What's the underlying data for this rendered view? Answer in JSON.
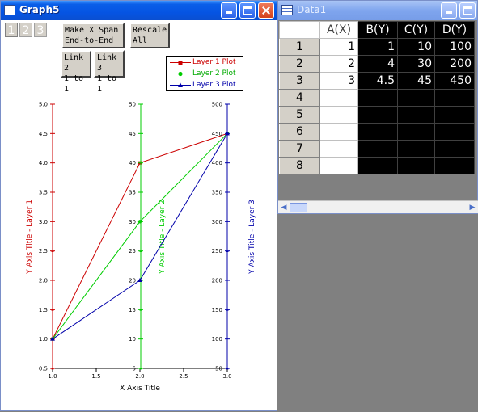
{
  "graph_window": {
    "title": "Graph5",
    "layer_tabs": [
      "1",
      "2",
      "3"
    ],
    "buttons": {
      "make_span_line1": "Make X Span",
      "make_span_line2": "End-to-End",
      "rescale_line1": "Rescale",
      "rescale_line2": "All",
      "link2_line1": "Link 2",
      "link2_line2": "1 to 1",
      "link3_line1": "Link 3",
      "link3_line2": "1 to 1"
    },
    "legend": [
      {
        "label": "Layer 1 Plot",
        "color": "#cc0000",
        "marker": "square"
      },
      {
        "label": "Layer 2 Plot",
        "color": "#00cc00",
        "marker": "circle"
      },
      {
        "label": "Layer 3 Plot",
        "color": "#0000aa",
        "marker": "triangle"
      }
    ]
  },
  "chart_data": {
    "type": "line",
    "xlabel": "X Axis Title",
    "xlim": [
      1.0,
      3.0
    ],
    "xticks": [
      "1.0",
      "1.5",
      "2.0",
      "2.5",
      "3.0"
    ],
    "x": [
      1,
      2,
      3
    ],
    "series": [
      {
        "name": "Layer 1 Plot",
        "axis_title": "Y Axis Title - Layer 1",
        "color": "#cc0000",
        "values": [
          1,
          4,
          4.5
        ],
        "ylim": [
          0.5,
          5.0
        ],
        "yticks": [
          "0.5",
          "1.0",
          "1.5",
          "2.0",
          "2.5",
          "3.0",
          "3.5",
          "4.0",
          "4.5",
          "5.0"
        ]
      },
      {
        "name": "Layer 2 Plot",
        "axis_title": "Y Axis Title - Layer 2",
        "color": "#00cc00",
        "values": [
          10,
          30,
          45
        ],
        "ylim": [
          5,
          50
        ],
        "yticks": [
          "5",
          "10",
          "15",
          "20",
          "25",
          "30",
          "35",
          "40",
          "45",
          "50"
        ]
      },
      {
        "name": "Layer 3 Plot",
        "axis_title": "Y Axis Title - Layer 3",
        "color": "#0000aa",
        "values": [
          100,
          200,
          450
        ],
        "ylim": [
          50,
          500
        ],
        "yticks": [
          "50",
          "100",
          "150",
          "200",
          "250",
          "300",
          "350",
          "400",
          "450",
          "500"
        ]
      }
    ]
  },
  "data_window": {
    "title": "Data1",
    "columns": [
      "A(X)",
      "B(Y)",
      "C(Y)",
      "D(Y)"
    ],
    "rows": [
      {
        "n": "1",
        "cells": [
          "1",
          "1",
          "10",
          "100"
        ]
      },
      {
        "n": "2",
        "cells": [
          "2",
          "4",
          "30",
          "200"
        ]
      },
      {
        "n": "3",
        "cells": [
          "3",
          "4.5",
          "45",
          "450"
        ]
      },
      {
        "n": "4",
        "cells": [
          "",
          "",
          "",
          ""
        ]
      },
      {
        "n": "5",
        "cells": [
          "",
          "",
          "",
          ""
        ]
      },
      {
        "n": "6",
        "cells": [
          "",
          "",
          "",
          ""
        ]
      },
      {
        "n": "7",
        "cells": [
          "",
          "",
          "",
          ""
        ]
      },
      {
        "n": "8",
        "cells": [
          "",
          "",
          "",
          ""
        ]
      }
    ]
  }
}
